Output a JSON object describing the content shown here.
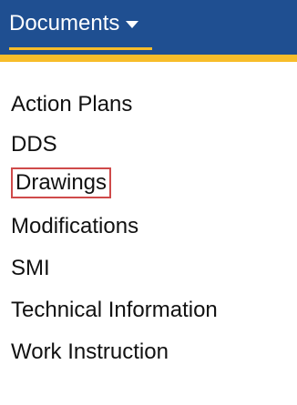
{
  "nav": {
    "title": "Documents",
    "caret_icon": "caret-down-icon"
  },
  "menu": {
    "items": [
      {
        "label": "Action Plans",
        "highlighted": false
      },
      {
        "label": "DDS",
        "highlighted": false
      },
      {
        "label": "Drawings",
        "highlighted": true
      },
      {
        "label": "Modifications",
        "highlighted": false
      },
      {
        "label": "SMI",
        "highlighted": false
      },
      {
        "label": "Technical Information",
        "highlighted": false
      },
      {
        "label": "Work Instruction",
        "highlighted": false
      }
    ]
  },
  "colors": {
    "nav_background": "#1f4f91",
    "nav_accent": "#f7bd2a",
    "highlight_border": "#cf4a4a",
    "text": "#111111"
  }
}
